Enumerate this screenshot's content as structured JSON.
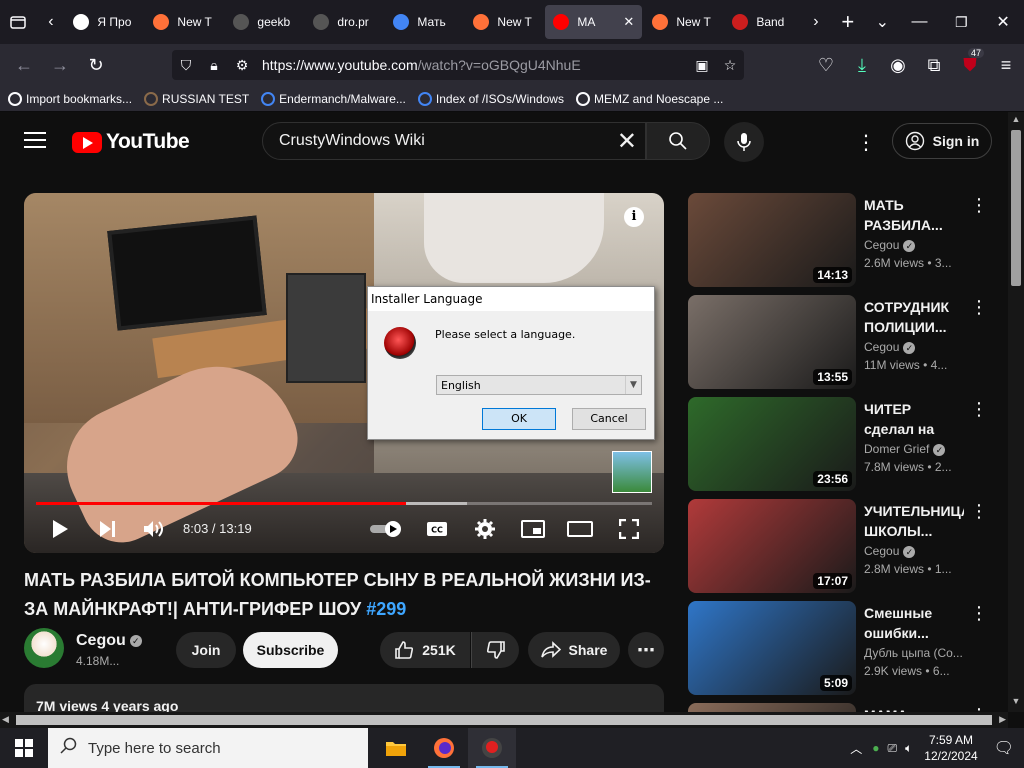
{
  "browser": {
    "tabs": [
      {
        "label": "Я Про",
        "favicon_color": "#ffffff",
        "active": false
      },
      {
        "label": "New T",
        "favicon_color": "#ff7139",
        "active": false
      },
      {
        "label": "geekb",
        "favicon_color": "#555555",
        "active": false
      },
      {
        "label": "dro.pr",
        "favicon_color": "#555555",
        "active": false
      },
      {
        "label": "Мать",
        "favicon_color": "#4285f4",
        "active": false
      },
      {
        "label": "New T",
        "favicon_color": "#ff7139",
        "active": false
      },
      {
        "label": "МА",
        "favicon_color": "#ff0000",
        "active": true
      },
      {
        "label": "New T",
        "favicon_color": "#ff7139",
        "active": false
      },
      {
        "label": "Band",
        "favicon_color": "#cc1e1e",
        "active": false
      }
    ],
    "url_host": "https://www.youtube.com",
    "url_path": "/watch?v=oGBQgU4NhuE",
    "extension_badge": "47",
    "bookmarks": [
      {
        "label": "Import bookmarks...",
        "icon": "import-icon"
      },
      {
        "label": "RUSSIAN TEST",
        "icon": "site-icon"
      },
      {
        "label": "Endermanch/Malware...",
        "icon": "google-icon"
      },
      {
        "label": "Index of /ISOs/Windows",
        "icon": "google-icon"
      },
      {
        "label": "MEMZ and Noescape ...",
        "icon": "globe-icon"
      }
    ]
  },
  "youtube": {
    "logo_text": "YouTube",
    "search_query": "CrustyWindows Wiki",
    "signin_label": "Sign in",
    "player": {
      "time_current": "8:03",
      "time_total": "13:19",
      "progress": 0.6
    },
    "video": {
      "title": "МАТЬ РАЗБИЛА БИТОЙ КОМПЬЮТЕР СЫНУ В РЕАЛЬНОЙ ЖИЗНИ ИЗ-ЗА МАЙНКРАФТ!| АНТИ-ГРИФЕР ШОУ",
      "hashtag": "#299",
      "channel": "Cegou",
      "subscribers": "4.18M...",
      "join_label": "Join",
      "subscribe_label": "Subscribe",
      "likes": "251K",
      "share_label": "Share",
      "views_date": "7M views  4 years ago"
    },
    "recommendations": [
      {
        "title": "МАТЬ РАЗБИЛА...",
        "channel": "Cegou",
        "verified": true,
        "stats": "2.6M views  • 3...",
        "duration": "14:13",
        "thumb": "#6b4a3a"
      },
      {
        "title": "СОТРУДНИК ПОЛИЦИИ...",
        "channel": "Cegou",
        "verified": true,
        "stats": "11M views  • 4...",
        "duration": "13:55",
        "thumb": "#7a6f68"
      },
      {
        "title": "ЧИТЕР сделал на меня...",
        "channel": "Domer Grief",
        "verified": true,
        "stats": "7.8M views  • 2...",
        "duration": "23:56",
        "thumb": "#2e6a2a"
      },
      {
        "title": "УЧИТЕЛЬНИЦА ШКОЛЫ...",
        "channel": "Cegou",
        "verified": true,
        "stats": "2.8M views  • 1...",
        "duration": "17:07",
        "thumb": "#b13a3a"
      },
      {
        "title": "Смешные ошибки...",
        "channel": "Дубль цыпа (Со...",
        "verified": false,
        "stats": "2.9K views  • 6...",
        "duration": "5:09",
        "thumb": "#2f76c8"
      },
      {
        "title": "МАМА",
        "channel": "",
        "verified": false,
        "stats": "",
        "duration": "",
        "thumb": "#8a6c5a"
      }
    ]
  },
  "dialog": {
    "title": "Installer Language",
    "message": "Please select a language.",
    "selected_language": "English",
    "ok_label": "OK",
    "cancel_label": "Cancel"
  },
  "taskbar": {
    "search_placeholder": "Type here to search",
    "time": "7:59 AM",
    "date": "12/2/2024"
  }
}
